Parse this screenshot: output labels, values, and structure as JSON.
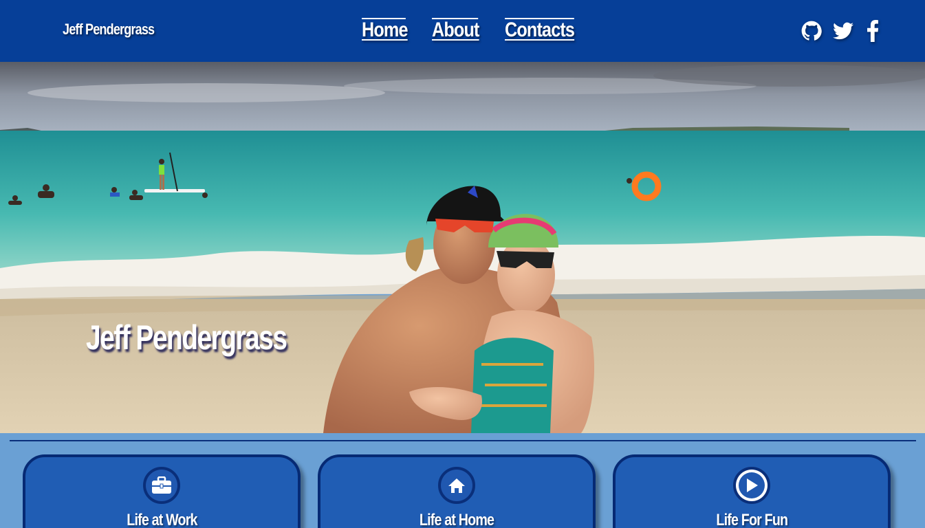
{
  "navbar": {
    "brand": "Jeff Pendergrass",
    "links": [
      "Home",
      "About",
      "Contacts"
    ],
    "social_icons": [
      "github-icon",
      "twitter-icon",
      "facebook-icon"
    ],
    "background_color": "#063f98"
  },
  "hero": {
    "title": "Jeff Pendergrass",
    "image_description_icon": "beach-photo"
  },
  "cards": [
    {
      "label": "Life at Work",
      "icon": "briefcase-icon"
    },
    {
      "label": "Life at Home",
      "icon": "home-icon"
    },
    {
      "label": "Life For Fun",
      "icon": "play-icon"
    }
  ],
  "colors": {
    "page_background": "#6aa0d4",
    "card_background": "#205db4",
    "card_border": "#062a74"
  }
}
